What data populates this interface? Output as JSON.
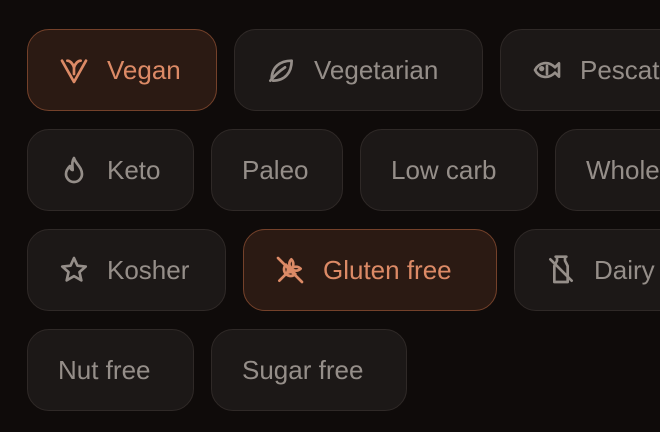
{
  "filters": {
    "accent_color": "#dc8a66",
    "chips": [
      {
        "label": "Vegan",
        "icon": "vegan-icon",
        "selected": true
      },
      {
        "label": "Vegetarian",
        "icon": "leaf-icon",
        "selected": false
      },
      {
        "label": "Pescat",
        "icon": "fish-icon",
        "selected": false
      },
      {
        "label": "Keto",
        "icon": "flame-icon",
        "selected": false
      },
      {
        "label": "Paleo",
        "icon": null,
        "selected": false
      },
      {
        "label": "Low carb",
        "icon": null,
        "selected": false
      },
      {
        "label": "Whole",
        "icon": null,
        "selected": false
      },
      {
        "label": "Kosher",
        "icon": "star-icon",
        "selected": false
      },
      {
        "label": "Gluten free",
        "icon": "wheat-off-icon",
        "selected": true
      },
      {
        "label": "Dairy",
        "icon": "milk-off-icon",
        "selected": false
      },
      {
        "label": "Nut free",
        "icon": null,
        "selected": false
      },
      {
        "label": "Sugar free",
        "icon": null,
        "selected": false
      }
    ]
  }
}
